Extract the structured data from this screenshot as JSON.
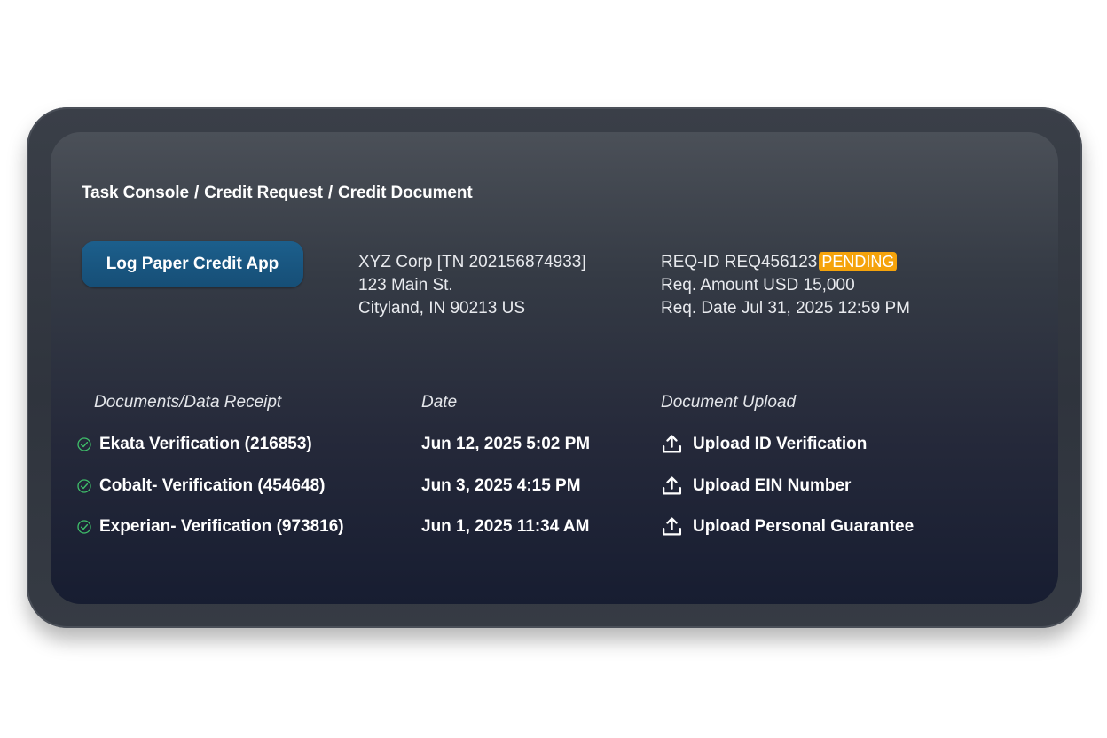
{
  "breadcrumb": [
    "Task Console",
    "Credit Request",
    "Credit Document"
  ],
  "log_button_label": "Log Paper Credit App",
  "company": {
    "name_line": "XYZ Corp [TN 202156874933]",
    "street": "123 Main St.",
    "city_line": "Cityland, IN 90213 US"
  },
  "request": {
    "id_line": "REQ-ID REQ456123",
    "status": "PENDING",
    "amount_line": "Req. Amount USD 15,000",
    "date_line": "Req. Date Jul 31, 2025 12:59 PM"
  },
  "columns": {
    "documents": "Documents/Data Receipt",
    "date": "Date",
    "upload": "Document Upload"
  },
  "rows": [
    {
      "check_icon": "check-circle-icon",
      "document": "Ekata Verification (216853)",
      "date": "Jun 12, 2025 5:02 PM",
      "upload_icon": "upload-icon",
      "upload_label": "Upload ID Verification"
    },
    {
      "check_icon": "check-circle-icon",
      "document": "Cobalt- Verification (454648)",
      "date": "Jun 3, 2025 4:15 PM",
      "upload_icon": "upload-icon",
      "upload_label": "Upload EIN Number"
    },
    {
      "check_icon": "check-circle-icon",
      "document": "Experian- Verification (973816)",
      "date": "Jun 1, 2025 11:34 AM",
      "upload_icon": "upload-icon",
      "upload_label": "Upload Personal Guarantee"
    }
  ],
  "colors": {
    "button": "#1a5a86",
    "pending_badge": "#f5a30b",
    "check_green": "#3fbf6a"
  }
}
